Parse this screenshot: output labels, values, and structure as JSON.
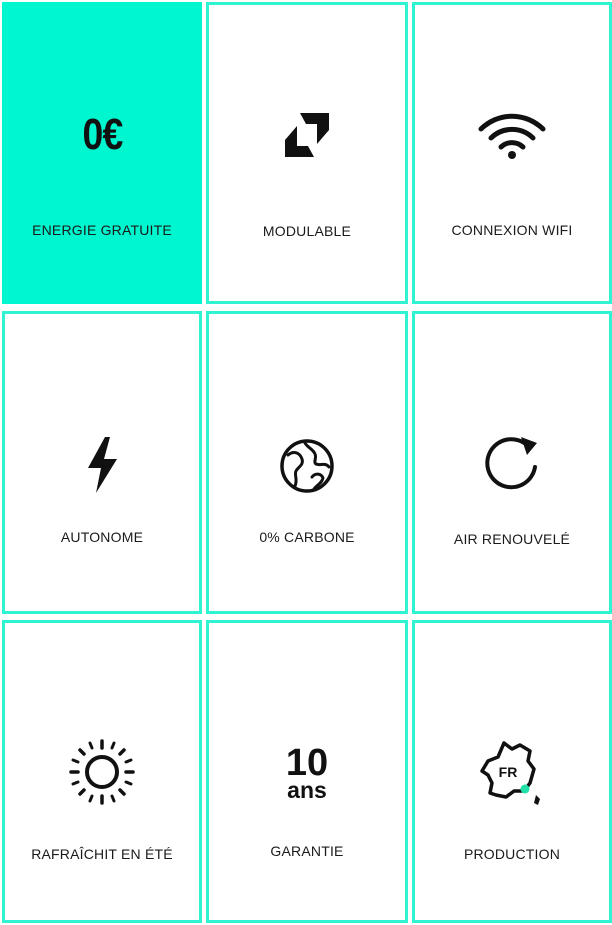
{
  "features": [
    {
      "big_text": "0€",
      "label": "ENERGIE GRATUITE",
      "icon": "euro-text"
    },
    {
      "label": "MODULABLE",
      "icon": "modular-icon"
    },
    {
      "label": "CONNEXION WIFI",
      "icon": "wifi-icon"
    },
    {
      "label": "AUTONOME",
      "icon": "lightning-icon"
    },
    {
      "label": "0% CARBONE",
      "icon": "globe-icon"
    },
    {
      "label": "AIR RENOUVELÉ",
      "icon": "refresh-icon"
    },
    {
      "label": "RAFRAÎCHIT EN ÉTÉ",
      "icon": "sun-icon"
    },
    {
      "big_number": "10",
      "big_unit": "ans",
      "label": "GARANTIE",
      "icon": "warranty-text"
    },
    {
      "badge": "FR",
      "label": "PRODUCTION",
      "icon": "france-map-icon"
    }
  ],
  "colors": {
    "accent": "#00f6cf",
    "border": "#2ff3d1",
    "text": "#1a1a1a"
  }
}
